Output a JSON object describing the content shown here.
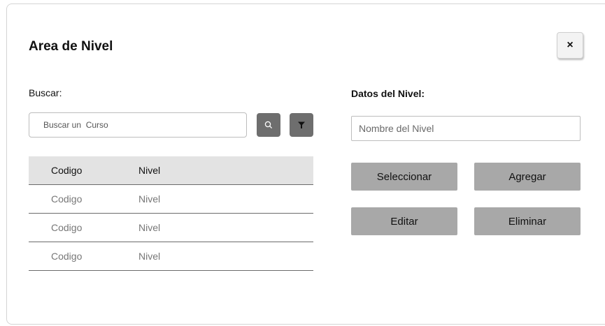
{
  "dialog": {
    "title": "Area de Nivel",
    "close_label": "×"
  },
  "search": {
    "label": "Buscar:",
    "placeholder": "Buscar un  Curso",
    "search_icon": "search-icon",
    "filter_icon": "filter-icon"
  },
  "table": {
    "headers": [
      "Codigo",
      "Nivel"
    ],
    "rows": [
      [
        "Codigo",
        "Nivel"
      ],
      [
        "Codigo",
        "Nivel"
      ],
      [
        "Codigo",
        "Nivel"
      ]
    ]
  },
  "details": {
    "label": "Datos del Nivel:",
    "name_placeholder": "Nombre del Nivel"
  },
  "actions": {
    "select": "Seleccionar",
    "add": "Agregar",
    "edit": "Editar",
    "delete": "Eliminar"
  },
  "colors": {
    "button_bg": "#a8a8a8",
    "icon_button_bg": "#6e6e6e",
    "header_bg": "#e3e3e3"
  }
}
